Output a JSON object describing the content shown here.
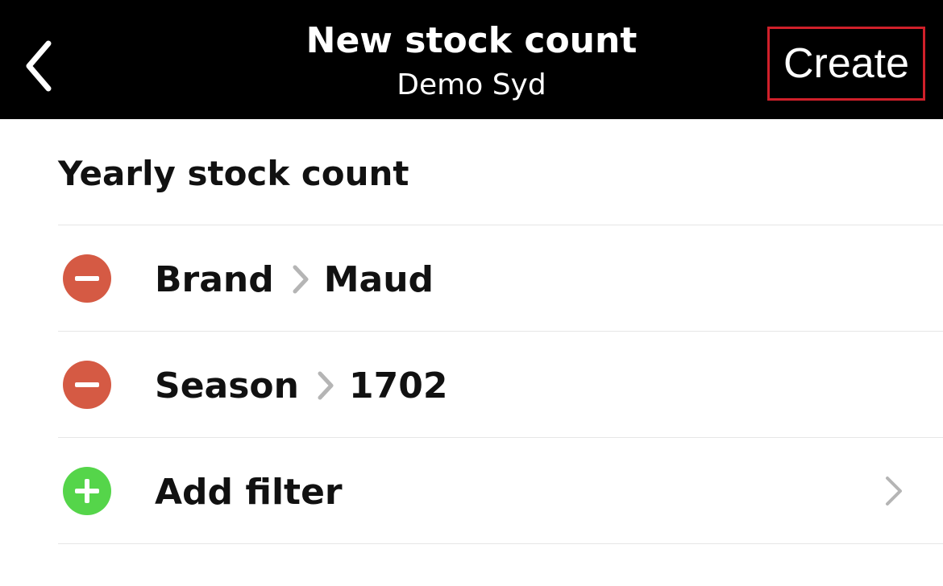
{
  "nav": {
    "title": "New stock count",
    "subtitle": "Demo Syd",
    "create_label": "Create",
    "back_icon": "chevron-left-icon",
    "create_highlight_color": "#d0202a"
  },
  "count": {
    "name": "Yearly stock count"
  },
  "filters": [
    {
      "field": "Brand",
      "value": "Maud",
      "icon": "remove-circle-icon",
      "icon_color": "#d55a44"
    },
    {
      "field": "Season",
      "value": "1702",
      "icon": "remove-circle-icon",
      "icon_color": "#d55a44"
    }
  ],
  "add_filter": {
    "label": "Add filter",
    "icon": "add-circle-icon",
    "icon_color": "#55d54a",
    "trailing_icon": "chevron-right-icon"
  }
}
